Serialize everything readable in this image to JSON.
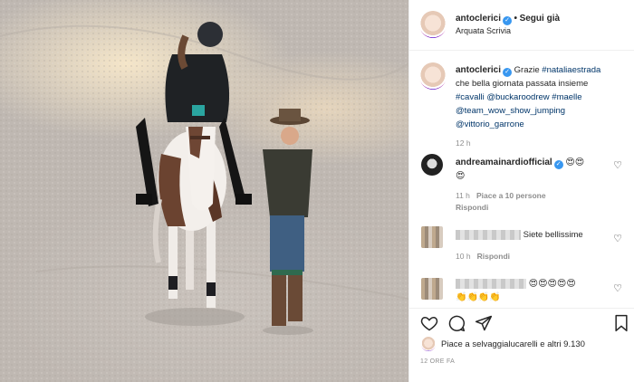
{
  "post": {
    "username": "antoclerici",
    "verified_mark": "✓",
    "separator": "•",
    "follow_label": "Segui già",
    "location": "Arquata Scrivia"
  },
  "caption": {
    "username": "antoclerici",
    "line1_prefix": "Grazie ",
    "line1_link": "#nataliaestrada",
    "line2": "che bella giornata passata insieme",
    "line3_a": "#cavalli",
    "line3_b": "@buckaroodrew",
    "line3_c": "#maelle",
    "line4": "@team_wow_show_jumping",
    "line5": "@vittorio_garrone",
    "time": "12 h"
  },
  "comments": [
    {
      "username": "andreamainardiofficial",
      "text": "😍😍",
      "text2": "😍",
      "time": "11 h",
      "likes": "Piace a 10 persone",
      "reply": "Rispondi"
    },
    {
      "username": "",
      "text": "Siete bellissime",
      "time": "10 h",
      "reply": "Rispondi"
    },
    {
      "username": "",
      "text": "😍😍😍😍😍",
      "text2": "👏👏👏👏",
      "time": "",
      "reply": ""
    }
  ],
  "icons": {
    "heart": "♡",
    "comment": "○",
    "share": "➤",
    "bookmark": "⚑"
  },
  "likes_text": "Piace a selvaggialucarelli e altri 9.130",
  "post_time": "12 ORE FA",
  "colors": {
    "link": "#003569",
    "verified": "#3897f0",
    "muted": "#8e8e8e"
  }
}
